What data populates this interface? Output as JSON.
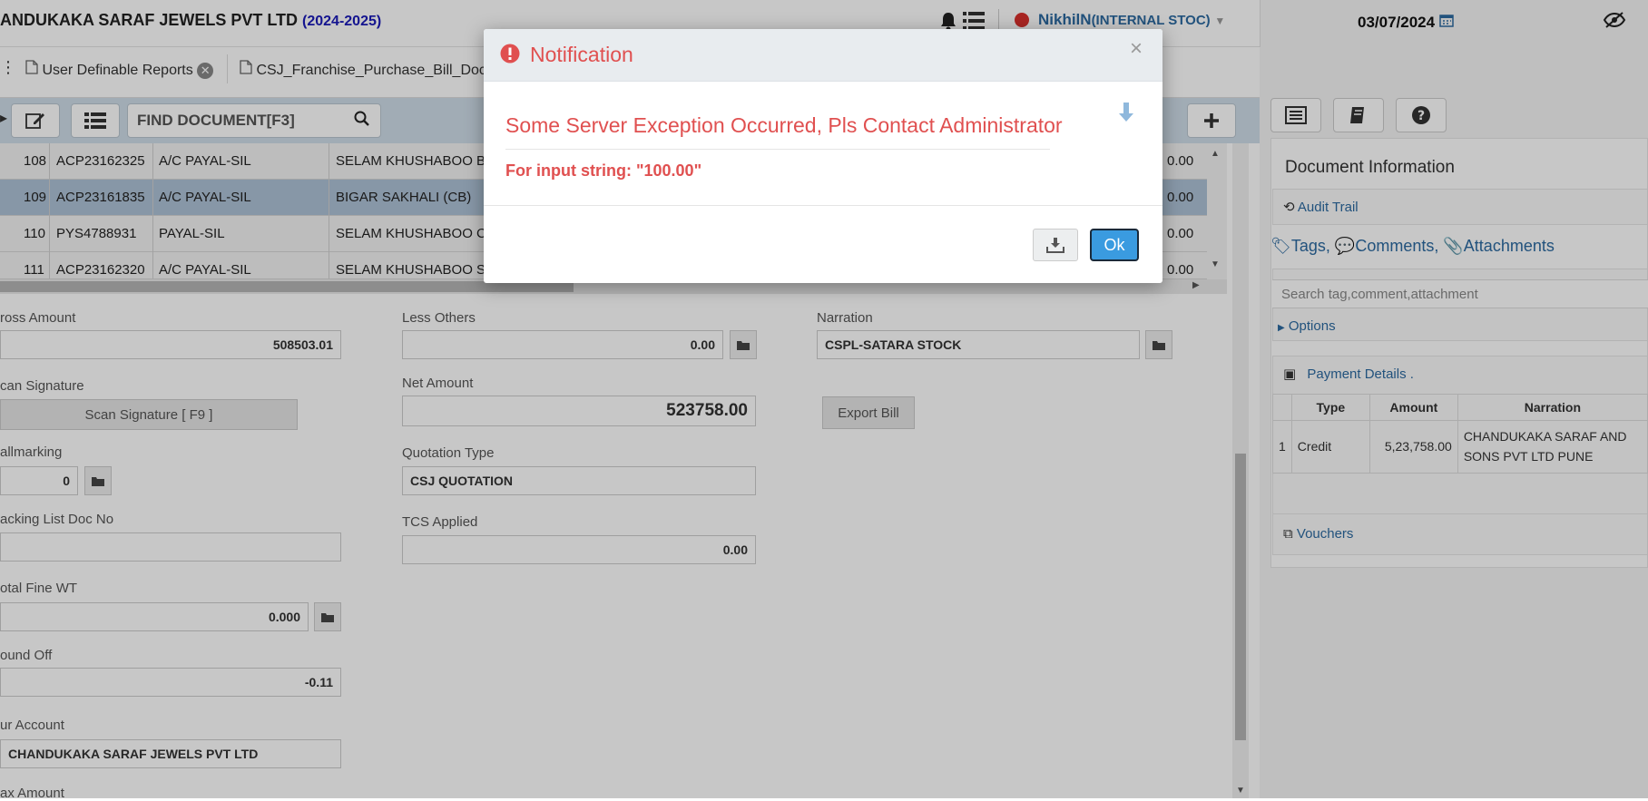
{
  "header": {
    "company": "ANDUKAKA SARAF JEWELS PVT LTD",
    "year": "(2024-2025)",
    "user": "NikhilN",
    "location": "(INTERNAL STOC)",
    "date": "03/07/2024"
  },
  "tabs": [
    {
      "label": "User Definable Reports"
    },
    {
      "label": "CSJ_Franchise_Purchase_Bill_Doc"
    }
  ],
  "toolbar": {
    "find_placeholder": "FIND DOCUMENT[F3]"
  },
  "grid": {
    "rows": [
      {
        "no": "108",
        "doc": "ACP23162325",
        "account": "A/C PAYAL-SIL",
        "party": "SELAM KHUSHABOO B",
        "amt": "0.00",
        "selected": false
      },
      {
        "no": "109",
        "doc": "ACP23161835",
        "account": "A/C PAYAL-SIL",
        "party": "BIGAR SAKHALI (CB)",
        "amt": "0.00",
        "selected": true
      },
      {
        "no": "110",
        "doc": "PYS4788931",
        "account": "PAYAL-SIL",
        "party": "SELAM KHUSHABOO C",
        "amt": "0.00",
        "selected": false
      },
      {
        "no": "111",
        "doc": "ACP23162320",
        "account": "A/C PAYAL-SIL",
        "party": "SELAM KHUSHABOO S",
        "amt": "0.00",
        "selected": false
      }
    ]
  },
  "form": {
    "gross_amount_label": "ross Amount",
    "gross_amount": "508503.01",
    "scan_signature_label": "can Signature",
    "scan_signature_button": "Scan Signature [ F9 ]",
    "hallmarking_label": "allmarking",
    "hallmarking": "0",
    "packing_list_label": "acking List Doc No",
    "packing_list": "",
    "total_fine_label": "otal Fine WT",
    "total_fine": "0.000",
    "round_off_label": "ound Off",
    "round_off": "-0.11",
    "our_account_label": "ur Account",
    "our_account": "CHANDUKAKA SARAF JEWELS PVT LTD",
    "tax_amount_label": "ax Amount",
    "less_others_label": "Less Others",
    "less_others": "0.00",
    "net_amount_label": "Net Amount",
    "net_amount": "523758.00",
    "quotation_type_label": "Quotation Type",
    "quotation_type": "CSJ QUOTATION",
    "tcs_label": "TCS Applied",
    "tcs": "0.00",
    "narration_label": "Narration",
    "narration": "CSPL-SATARA STOCK",
    "export_bill": "Export Bill"
  },
  "right_panel": {
    "title": "Document Information",
    "audit_trail": "Audit Trail",
    "tags": "Tags,",
    "comments": "Comments,",
    "attachments": "Attachments",
    "search_placeholder": "Search tag,comment,attachment",
    "options": "Options",
    "payment_details": "Payment Details .",
    "payment_headers": [
      "Type",
      "Amount",
      "Narration"
    ],
    "payment_rows": [
      {
        "idx": "1",
        "type": "Credit",
        "amount": "5,23,758.00",
        "narration": "CHANDUKAKA SARAF AND SONS PVT LTD PUNE"
      }
    ],
    "vouchers": "Vouchers"
  },
  "modal": {
    "title": "Notification",
    "message": "Some Server Exception Occurred, Pls Contact Administrator",
    "detail": "For input string: \"100.00\"",
    "ok": "Ok",
    "close": "×"
  },
  "colors": {
    "error": "#e05050",
    "accent": "#2c6aa0",
    "ok_button": "#3a9be0",
    "selected_row": "#aec2d6"
  }
}
